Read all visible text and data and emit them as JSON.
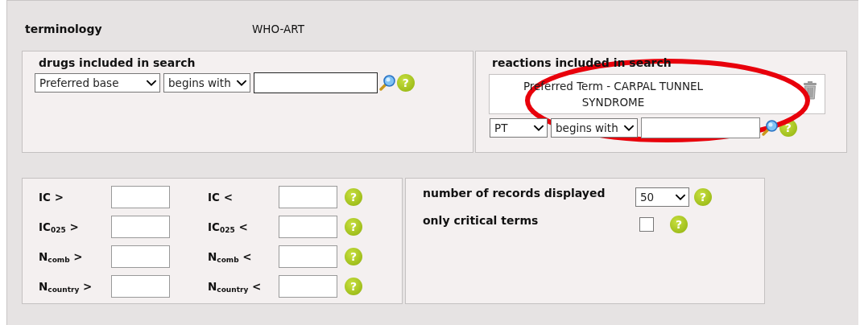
{
  "terminology": {
    "label": "terminology",
    "value": "WHO-ART"
  },
  "drugs": {
    "title": "drugs included in search",
    "field_select": "Preferred base",
    "match_select": "begins with",
    "help": "?"
  },
  "reactions": {
    "title": "reactions included in search",
    "terms": [
      {
        "text": "Preferred Term - CARPAL TUNNEL SYNDROME"
      }
    ],
    "field_select": "PT",
    "match_select": "begins with",
    "help": "?"
  },
  "thresholds": [
    {
      "min_label": "IC >",
      "max_label": "IC <",
      "help": "?"
    },
    {
      "min_label": "IC$_{025}$ >",
      "max_label": "IC$_{025}$ <",
      "help": "?"
    },
    {
      "min_label": "N$_{comb}$ >",
      "max_label": "N$_{comb}$ <",
      "help": "?"
    },
    {
      "min_label": "N$_{country}$ >",
      "max_label": "N$_{country}$ <",
      "help": "?"
    }
  ],
  "options": [
    {
      "kind": "select",
      "label": "number of records displayed",
      "value": "50",
      "help": "?"
    },
    {
      "kind": "checkbox",
      "label": "only critical terms",
      "checked": false,
      "help": "?"
    }
  ],
  "annotation": {
    "kind": "ellipse",
    "color": "#e8000b"
  }
}
